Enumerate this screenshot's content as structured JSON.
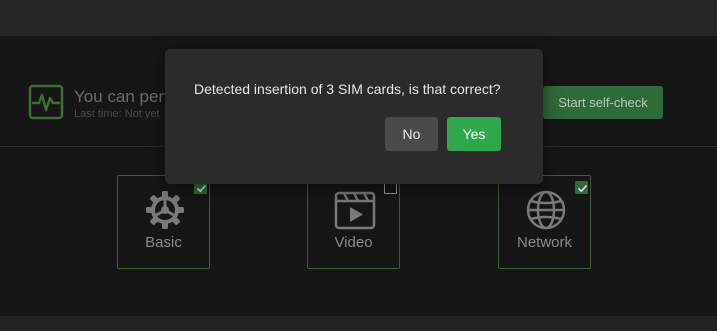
{
  "selfcheck": {
    "title": "You can perform a self-check",
    "subtitle": "Last time: Not yet",
    "start_label": "Start self-check",
    "icon": "heartbeat-monitor-icon"
  },
  "cards": [
    {
      "label": "Basic",
      "icon": "gear-icon",
      "checked": true
    },
    {
      "label": "Video",
      "icon": "video-clapper-icon",
      "checked": false
    },
    {
      "label": "Network",
      "icon": "globe-icon",
      "checked": true
    }
  ],
  "dialog": {
    "message": "Detected insertion of 3 SIM cards, is that correct?",
    "no_label": "No",
    "yes_label": "Yes"
  },
  "colors": {
    "accent_green": "#2ea84a",
    "dark_green": "#2f6a3a",
    "card_border": "#3f5e33",
    "background": "#161616"
  }
}
